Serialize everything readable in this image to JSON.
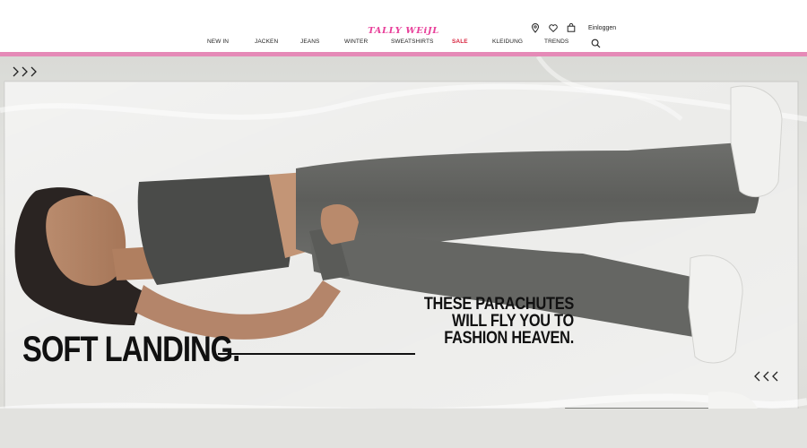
{
  "header": {
    "logo": "TALLY WEiJL",
    "login_label": "Einloggen",
    "icons": [
      "location-pin-icon",
      "heart-icon",
      "shopping-bag-icon",
      "search-icon"
    ]
  },
  "nav": {
    "items": [
      {
        "label": "NEW IN"
      },
      {
        "label": "JACKEN"
      },
      {
        "label": "JEANS"
      },
      {
        "label": "WINTER"
      },
      {
        "label": "SWEATSHIRTS"
      },
      {
        "label": "SALE"
      },
      {
        "label": "KLEIDUNG"
      },
      {
        "label": "TRENDS"
      }
    ]
  },
  "hero": {
    "tagline": [
      "THESE PARACHUTES",
      "WILL FLY YOU TO",
      "FASHION HEAVEN."
    ],
    "headline": "SOFT LANDING.",
    "arrows_left": "›››",
    "arrows_right": "‹‹‹"
  },
  "colors": {
    "brand_pink": "#e8409a",
    "bar_pink": "#e58ab7",
    "sale_red": "#d8253f"
  }
}
